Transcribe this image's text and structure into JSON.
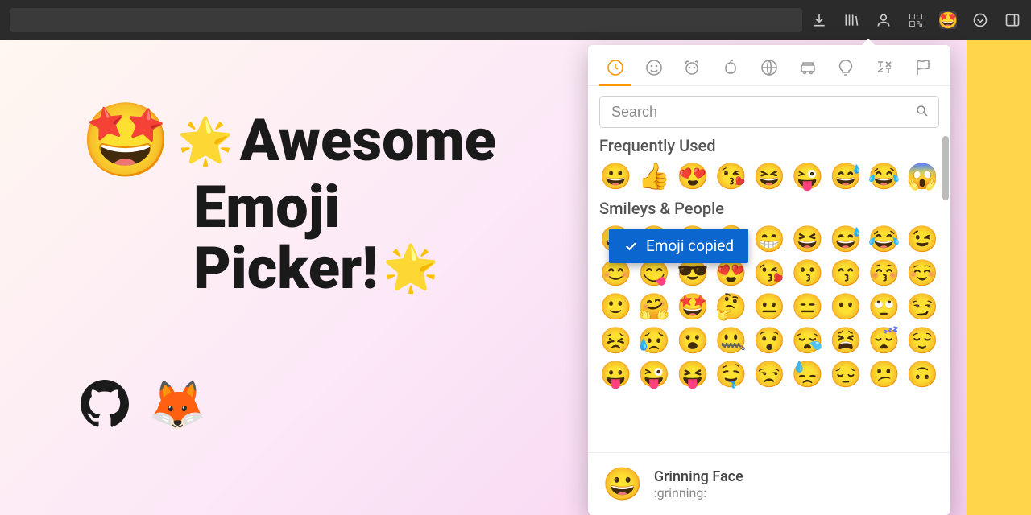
{
  "hero": {
    "big_emoji": "🤩",
    "star": "🌟",
    "line1": "Awesome",
    "line2": "Emoji",
    "line3": "Picker!"
  },
  "toolbar_icons": [
    "download",
    "library",
    "account",
    "qr",
    "emoji",
    "pocket",
    "sidebar"
  ],
  "picker": {
    "search_placeholder": "Search",
    "categories": [
      "recent",
      "smileys",
      "animals",
      "food",
      "activity",
      "travel",
      "objects",
      "symbols",
      "flags"
    ],
    "section_freq_title": "Frequently Used",
    "freq": [
      "😀",
      "👍",
      "😍",
      "😘",
      "😆",
      "😜",
      "😅",
      "😂",
      "😱"
    ],
    "section_people_title": "Smileys & People",
    "people": [
      "😀",
      "😃",
      "😄",
      "🤣",
      "😁",
      "😆",
      "😅",
      "😂",
      "😉",
      "😊",
      "😋",
      "😎",
      "😍",
      "😘",
      "😗",
      "😙",
      "😚",
      "☺️",
      "🙂",
      "🤗",
      "🤩",
      "🤔",
      "😐",
      "😑",
      "😶",
      "🙄",
      "😏",
      "😣",
      "😥",
      "😮",
      "🤐",
      "😯",
      "😪",
      "😫",
      "😴",
      "😌",
      "😛",
      "😜",
      "😝",
      "🤤",
      "😒",
      "😓",
      "😔",
      "😕",
      "🙃"
    ],
    "preview_emoji": "😀",
    "preview_name": "Grinning Face",
    "preview_code": ":grinning:"
  },
  "toast": "Emoji copied"
}
